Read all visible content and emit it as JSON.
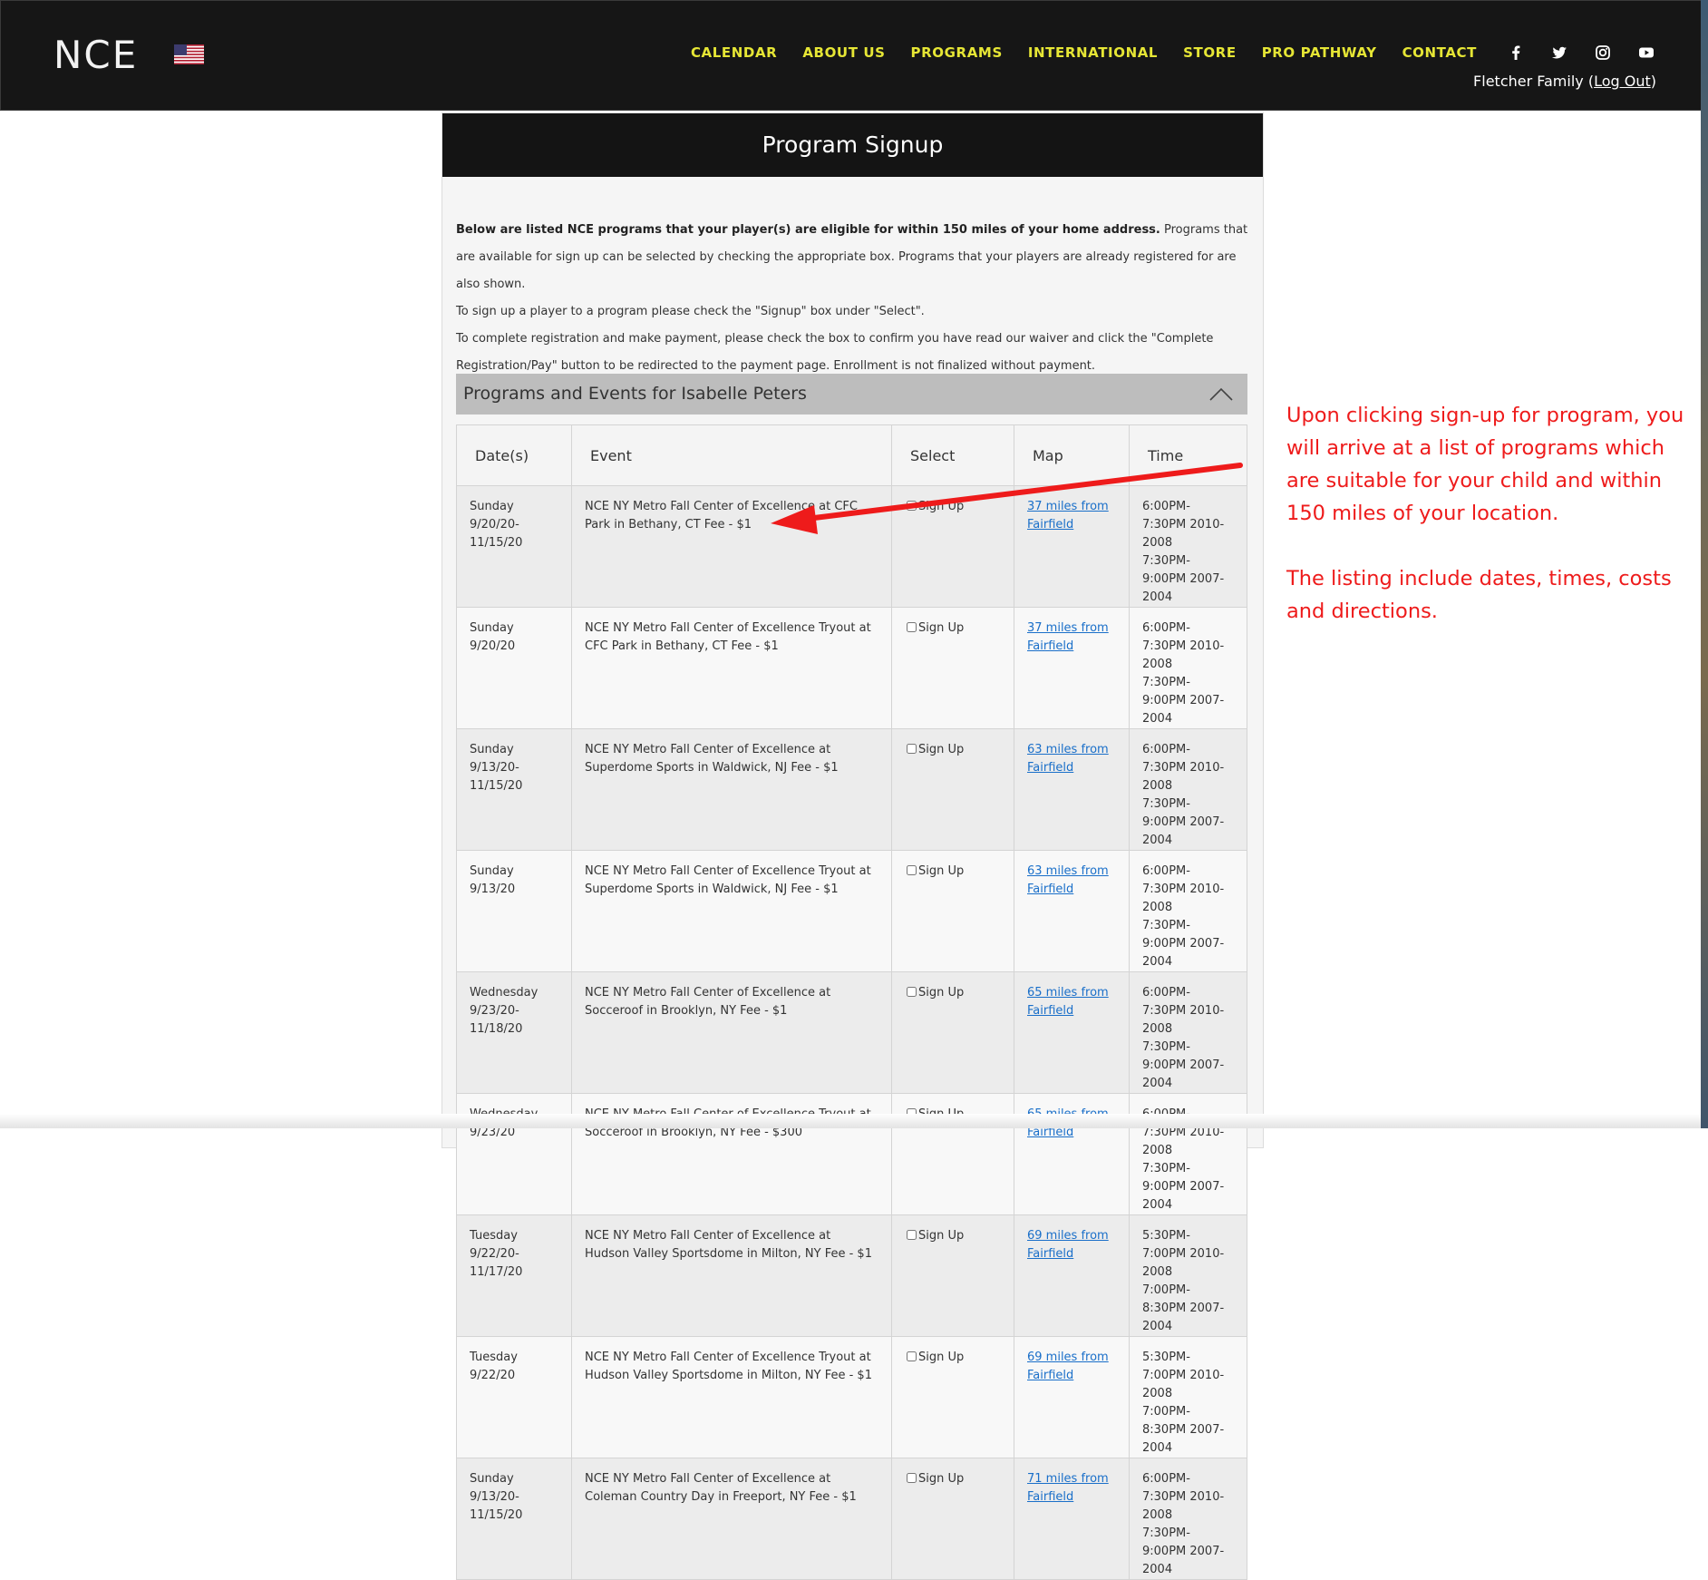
{
  "header": {
    "logo_text": "NCE",
    "flag_icon": "us-flag-icon",
    "nav": [
      "CALENDAR",
      "ABOUT US",
      "PROGRAMS",
      "INTERNATIONAL",
      "STORE",
      "PRO PATHWAY",
      "CONTACT"
    ],
    "social_icons": [
      "facebook-icon",
      "twitter-icon",
      "instagram-icon",
      "youtube-icon"
    ],
    "account_name": "Fletcher Family (",
    "logout_label": "Log Out",
    "account_close": ")",
    "nav_color": "#e6e635"
  },
  "panel": {
    "title": "Program Signup",
    "intro_bold": "Below are listed NCE programs that your player(s) are eligible for within 150 miles of your home address.",
    "intro_rest": " Programs that are available for sign up can be selected by checking the appropriate box. Programs that your players are already registered for are also shown.",
    "intro_2": "To sign up a player to a program please check the \"Signup\" box under \"Select\".",
    "intro_3": "To complete registration and make payment, please check the box to confirm you have read our waiver and click the \"Complete Registration/Pay\" button to be redirected to the payment page. Enrollment is not finalized without payment.",
    "group_title": "Programs and Events for Isabelle Peters",
    "columns": [
      "Date(s)",
      "Event",
      "Select",
      "Map",
      "Time"
    ],
    "signup_label": "Sign Up",
    "rows": [
      {
        "date": "Sunday 9/20/20-11/15/20",
        "event": "NCE NY Metro Fall Center of Excellence at CFC Park in Bethany, CT Fee - $1",
        "map": "37 miles from Fairfield",
        "time1": "6:00PM-7:30PM 2010-2008",
        "time2": "7:30PM-9:00PM 2007-2004"
      },
      {
        "date": "Sunday 9/20/20",
        "event": "NCE NY Metro Fall Center of Excellence Tryout at CFC Park in Bethany, CT Fee - $1",
        "map": "37 miles from Fairfield",
        "time1": "6:00PM-7:30PM 2010-2008",
        "time2": "7:30PM-9:00PM 2007-2004"
      },
      {
        "date": "Sunday 9/13/20-11/15/20",
        "event": "NCE NY Metro Fall Center of Excellence at Superdome Sports in Waldwick, NJ Fee - $1",
        "map": "63 miles from Fairfield",
        "time1": "6:00PM-7:30PM 2010-2008",
        "time2": "7:30PM-9:00PM 2007-2004"
      },
      {
        "date": "Sunday 9/13/20",
        "event": "NCE NY Metro Fall Center of Excellence Tryout at Superdome Sports in Waldwick, NJ Fee - $1",
        "map": "63 miles from Fairfield",
        "time1": "6:00PM-7:30PM 2010-2008",
        "time2": "7:30PM-9:00PM 2007-2004"
      },
      {
        "date": "Wednesday 9/23/20-11/18/20",
        "event": "NCE NY Metro Fall Center of Excellence at Socceroof in Brooklyn, NY Fee - $1",
        "map": "65 miles from Fairfield",
        "time1": "6:00PM-7:30PM 2010-2008",
        "time2": "7:30PM-9:00PM 2007-2004"
      },
      {
        "date": "Wednesday 9/23/20",
        "event": "NCE NY Metro Fall Center of Excellence Tryout at Socceroof in Brooklyn, NY Fee - $300",
        "map": "65 miles from Fairfield",
        "time1": "6:00PM-7:30PM 2010-2008",
        "time2": "7:30PM-9:00PM 2007-2004"
      },
      {
        "date": "Tuesday 9/22/20-11/17/20",
        "event": "NCE NY Metro Fall Center of Excellence at Hudson Valley Sportsdome in Milton, NY Fee - $1",
        "map": "69 miles from Fairfield",
        "time1": "5:30PM-7:00PM 2010-2008",
        "time2": "7:00PM-8:30PM 2007-2004"
      },
      {
        "date": "Tuesday 9/22/20",
        "event": "NCE NY Metro Fall Center of Excellence Tryout at Hudson Valley Sportsdome in Milton, NY Fee - $1",
        "map": "69 miles from Fairfield",
        "time1": "5:30PM-7:00PM 2010-2008",
        "time2": "7:00PM-8:30PM 2007-2004"
      },
      {
        "date": "Sunday 9/13/20-11/15/20",
        "event": "NCE NY Metro Fall Center of Excellence at Coleman Country Day in Freeport, NY Fee - $1",
        "map": "71 miles from Fairfield",
        "time1": "6:00PM-7:30PM 2010-2008",
        "time2": "7:30PM-9:00PM 2007-2004"
      }
    ]
  },
  "annotation": {
    "color": "#ee1b1b",
    "line1": "Upon clicking sign-up for program, you will arrive at a list of programs which are suitable for your child and within 150 miles of your location.",
    "line2": "The listing include dates, times, costs and directions."
  }
}
